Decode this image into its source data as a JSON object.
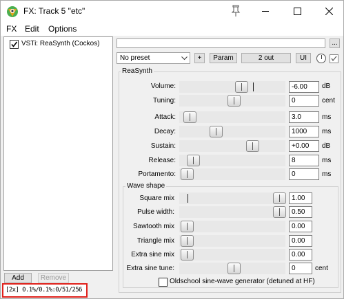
{
  "window": {
    "title": "FX: Track 5 \"etc\""
  },
  "icons": {
    "app": "reaper-logo-icon",
    "pin": "pin-icon",
    "minimize": "minimize-icon",
    "maximize": "maximize-icon",
    "close": "close-icon",
    "dropdown": "chevron-down-icon",
    "knob": "wet-knob-icon",
    "check": "checkmark-icon"
  },
  "colors": {
    "status_highlight": "#e0211b",
    "logo_green": "#4caf50",
    "logo_orange": "#e8a317"
  },
  "menu": [
    "FX",
    "Edit",
    "Options"
  ],
  "plugins": [
    {
      "label": "VSTi: ReaSynth (Cockos)",
      "enabled": true
    }
  ],
  "buttons": {
    "add": "Add",
    "remove": "Remove",
    "more": "...",
    "plus": "+",
    "param": "Param",
    "io": "2 out",
    "ui": "UI"
  },
  "status": "[2x] 0.1%/0.1%:0/51/256",
  "preset": {
    "name": "",
    "selected": "No preset"
  },
  "group_title": "ReaSynth",
  "params": [
    {
      "label": "Volume:",
      "value": "-6.00",
      "unit": "dB",
      "level": 0.38
    },
    {
      "label": "Tuning:",
      "value": "0",
      "unit": "cent",
      "level": 0.5
    },
    {
      "label": "Attack:",
      "value": "3.0",
      "unit": "ms",
      "level": 0.02
    },
    {
      "label": "Decay:",
      "value": "1000",
      "unit": "ms",
      "level": 0.27
    },
    {
      "label": "Sustain:",
      "value": "+0.00",
      "unit": "dB",
      "level": 0.63
    },
    {
      "label": "Release:",
      "value": "8",
      "unit": "ms",
      "level": 0.06
    },
    {
      "label": "Portamento:",
      "value": "0",
      "unit": "ms",
      "level": 0.0
    }
  ],
  "wave_shape": {
    "title": "Wave shape",
    "params": [
      {
        "label": "Square mix",
        "value": "1.00",
        "level": 1.0
      },
      {
        "label": "Pulse width:",
        "value": "0.50",
        "level": 1.0
      },
      {
        "label": "Sawtooth mix",
        "value": "0.00",
        "level": 0.0
      },
      {
        "label": "Triangle mix",
        "value": "0.00",
        "level": 0.0
      },
      {
        "label": "Extra sine mix",
        "value": "0.00",
        "level": 0.0
      },
      {
        "label": "Extra sine tune:",
        "value": "0",
        "unit": "cent",
        "level": 0.5
      }
    ],
    "oldschool": {
      "label": "Oldschool sine-wave generator (detuned at HF)",
      "checked": false
    }
  }
}
